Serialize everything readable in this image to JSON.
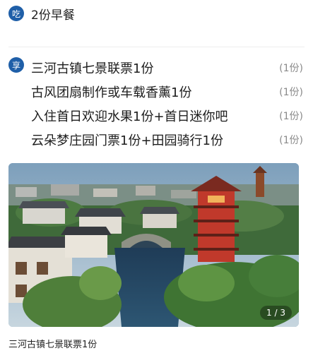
{
  "meal": {
    "badge": "吃",
    "text": "2份早餐"
  },
  "benefits": {
    "badge": "享",
    "items": [
      {
        "label": "三河古镇七景联票1份",
        "qty": "(1份)"
      },
      {
        "label": "古风团扇制作或车载香薰1份",
        "qty": "(1份)"
      },
      {
        "label": "入住首日欢迎水果1份+首日迷你吧",
        "qty": "(1份)"
      },
      {
        "label": "云朵梦庄园门票1份+田园骑行1份",
        "qty": "(1份)"
      }
    ]
  },
  "gallery": {
    "pager": "1 / 3",
    "caption": "三河古镇七景联票1份"
  },
  "colors": {
    "badge": "#1f5fa8",
    "qty": "#8a8a8a"
  },
  "icons": {
    "photo": "ancient-town-photo"
  }
}
